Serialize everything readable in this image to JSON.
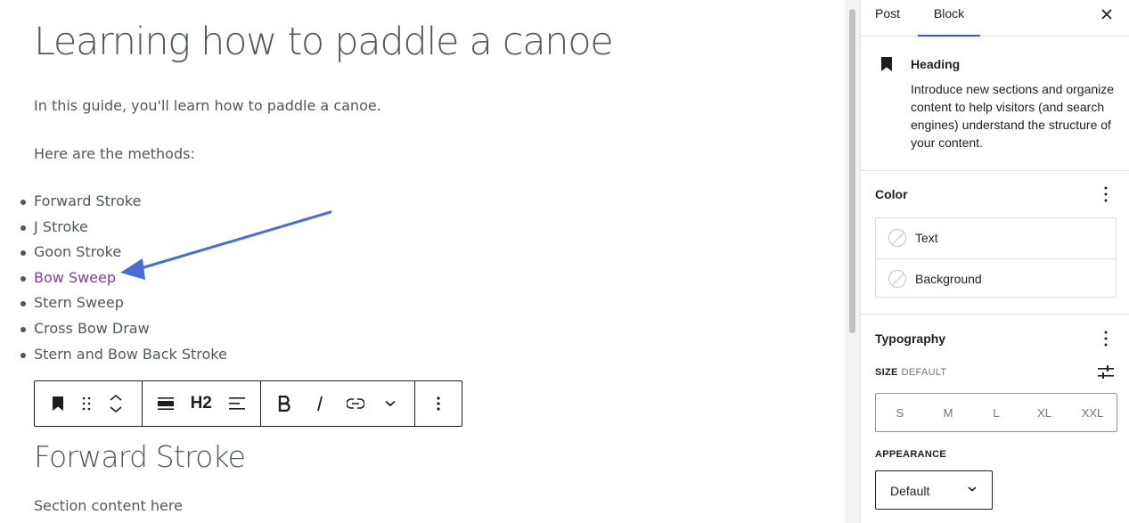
{
  "editor": {
    "title": "Learning how to paddle a canoe",
    "intro": "In this guide, you'll learn how to paddle a canoe.",
    "methods_intro": "Here are the methods:",
    "methods": [
      "Forward Stroke",
      "J Stroke",
      "Goon Stroke",
      "Bow Sweep",
      "Stern Sweep",
      "Cross Bow Draw",
      "Stern and Bow Back Stroke"
    ],
    "linked_item": "Bow Sweep",
    "toolbar": {
      "heading_level": "H2",
      "icons": [
        "bookmark-icon",
        "drag-handle-icon",
        "move-up-icon",
        "move-down-icon",
        "align-wide-icon",
        "align-left-icon",
        "bold-icon",
        "italic-icon",
        "link-icon",
        "chevron-down-icon",
        "more-vertical-icon"
      ]
    },
    "section_heading": "Forward Stroke",
    "section_content": "Section content here",
    "colors": {
      "text": "#50575e",
      "link": "#7b3fa8",
      "annotation_arrow": "#4a6cd4"
    }
  },
  "sidebar": {
    "tabs": [
      {
        "label": "Post",
        "active": false
      },
      {
        "label": "Block",
        "active": true
      }
    ],
    "block_card": {
      "title": "Heading",
      "description": "Introduce new sections and organize content to help visitors (and search engines) understand the structure of your content."
    },
    "color_panel": {
      "title": "Color",
      "items": [
        "Text",
        "Background"
      ]
    },
    "typography_panel": {
      "title": "Typography",
      "size_label": "SIZE",
      "size_value": "DEFAULT",
      "sizes": [
        "S",
        "M",
        "L",
        "XL",
        "XXL"
      ],
      "appearance_label": "APPEARANCE",
      "appearance_value": "Default"
    },
    "colors": {
      "accent": "#3858e9"
    }
  }
}
